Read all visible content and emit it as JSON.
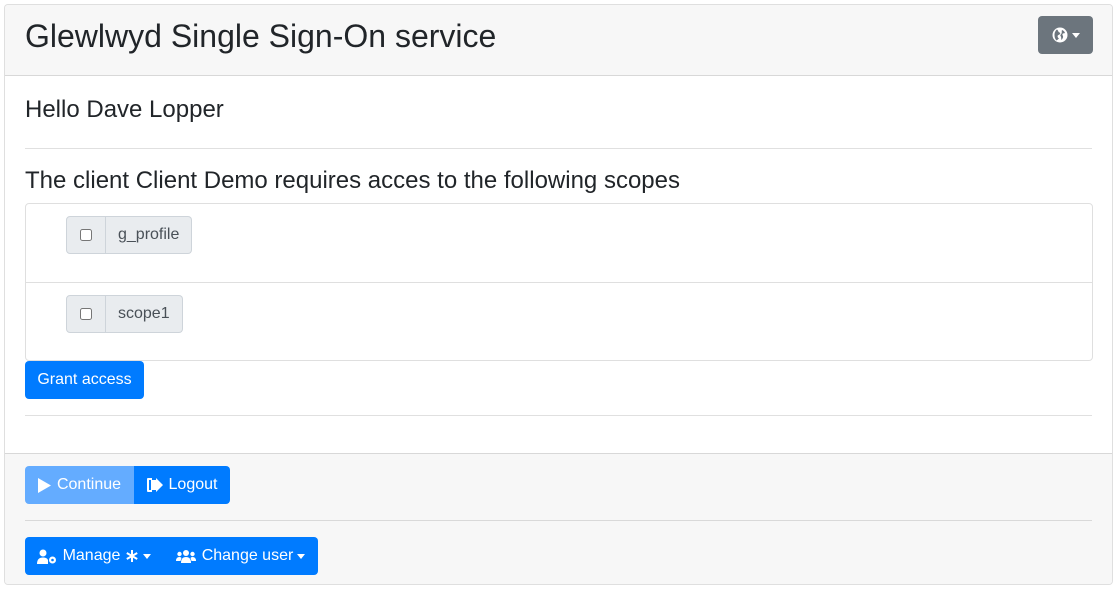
{
  "header": {
    "title": "Glewlwyd Single Sign-On service",
    "lang_icon": "globe-icon"
  },
  "greeting": "Hello Dave Lopper",
  "scopes": {
    "title": "The client Client Demo requires acces to the following scopes",
    "items": [
      {
        "label": "g_profile",
        "checked": false
      },
      {
        "label": "scope1",
        "checked": false
      }
    ],
    "grant_label": "Grant access"
  },
  "footer": {
    "continue_label": "Continue",
    "continue_icon": "play-icon",
    "logout_label": "Logout",
    "logout_icon": "sign-out-icon",
    "manage_label": "Manage",
    "manage_icon": "user-cog-icon",
    "change_user_label": "Change user",
    "change_user_icon": "users-icon"
  },
  "colors": {
    "primary": "#007bff",
    "primary_disabled": "#64acff",
    "secondary": "#6c757d",
    "header_bg": "#f7f7f7"
  }
}
